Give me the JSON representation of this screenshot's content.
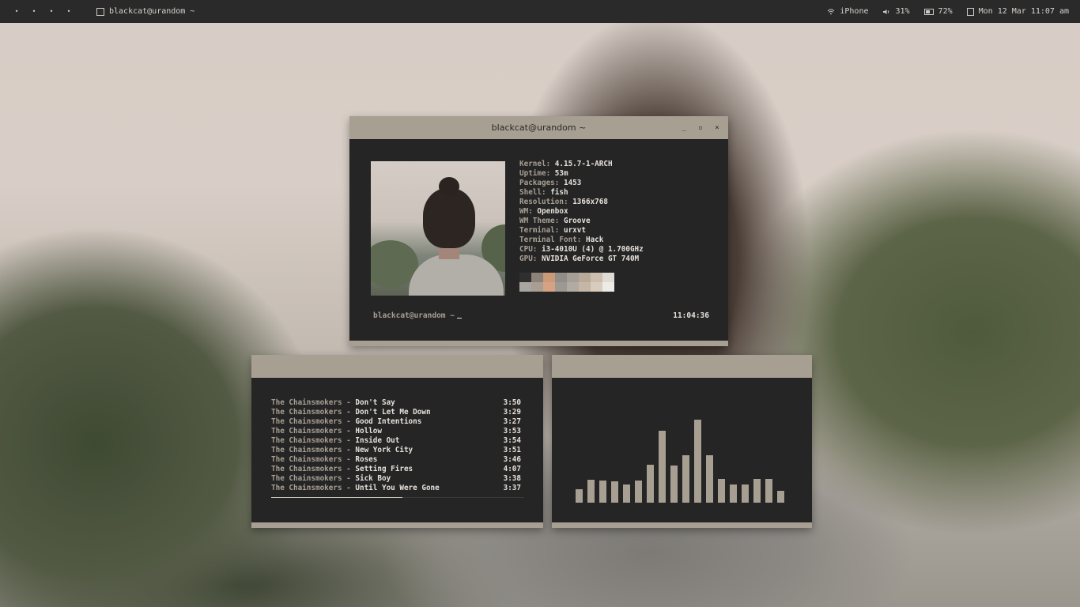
{
  "topbar": {
    "workspaces": [
      "•",
      "•",
      "•",
      "•"
    ],
    "window_title": "blackcat@urandom ~",
    "wifi": "iPhone",
    "volume": "31%",
    "battery": "72%",
    "datetime": "Mon 12 Mar 11:07 am"
  },
  "terminal": {
    "title": "blackcat@urandom ~",
    "info": [
      {
        "key": "Kernel:",
        "value": "4.15.7-1-ARCH"
      },
      {
        "key": "Uptime:",
        "value": "53m"
      },
      {
        "key": "Packages:",
        "value": "1453"
      },
      {
        "key": "Shell:",
        "value": "fish"
      },
      {
        "key": "Resolution:",
        "value": "1366x768"
      },
      {
        "key": "WM:",
        "value": "Openbox"
      },
      {
        "key": "WM Theme:",
        "value": "Groove"
      },
      {
        "key": "Terminal:",
        "value": "urxvt"
      },
      {
        "key": "Terminal Font:",
        "value": "Hack"
      },
      {
        "key": "CPU:",
        "value": "i3-4010U (4) @ 1.700GHz"
      },
      {
        "key": "GPU:",
        "value": "NVIDIA GeForce GT 740M"
      }
    ],
    "palette": [
      [
        "#2f2f2f",
        "#a9a6a1"
      ],
      [
        "#8d8278",
        "#a89e94"
      ],
      [
        "#cb9a78",
        "#d6a283"
      ],
      [
        "#918e87",
        "#9c9992"
      ],
      [
        "#a59f97",
        "#b1aba3"
      ],
      [
        "#b9a998",
        "#c5b6a6"
      ],
      [
        "#cdbfb0",
        "#d8ccbe"
      ],
      [
        "#e0dbd3",
        "#ecebe6"
      ]
    ],
    "prompt": "blackcat@urandom ~",
    "clock": "11:04:36"
  },
  "music": {
    "tracks": [
      {
        "artist": "The Chainsmokers",
        "title": "Don't Say",
        "duration": "3:50"
      },
      {
        "artist": "The Chainsmokers",
        "title": "Don't Let Me Down",
        "duration": "3:29"
      },
      {
        "artist": "The Chainsmokers",
        "title": "Good Intentions",
        "duration": "3:27"
      },
      {
        "artist": "The Chainsmokers",
        "title": "Hollow",
        "duration": "3:53"
      },
      {
        "artist": "The Chainsmokers",
        "title": "Inside Out",
        "duration": "3:54"
      },
      {
        "artist": "The Chainsmokers",
        "title": "New York City",
        "duration": "3:51"
      },
      {
        "artist": "The Chainsmokers",
        "title": "Roses",
        "duration": "3:46"
      },
      {
        "artist": "The Chainsmokers",
        "title": "Setting Fires",
        "duration": "4:07"
      },
      {
        "artist": "The Chainsmokers",
        "title": "Sick Boy",
        "duration": "3:38"
      },
      {
        "artist": "The Chainsmokers",
        "title": "Until You Were Gone",
        "duration": "3:37"
      }
    ],
    "separator": "-",
    "progress": 0.52
  },
  "visualizer": {
    "levels": [
      0.13,
      0.23,
      0.22,
      0.21,
      0.18,
      0.22,
      0.38,
      0.72,
      0.37,
      0.47,
      0.83,
      0.47,
      0.24,
      0.18,
      0.18,
      0.24,
      0.24,
      0.12
    ]
  },
  "colors": {
    "accent": "#a89f93",
    "background": "#252525",
    "text": "#e6e1db"
  }
}
